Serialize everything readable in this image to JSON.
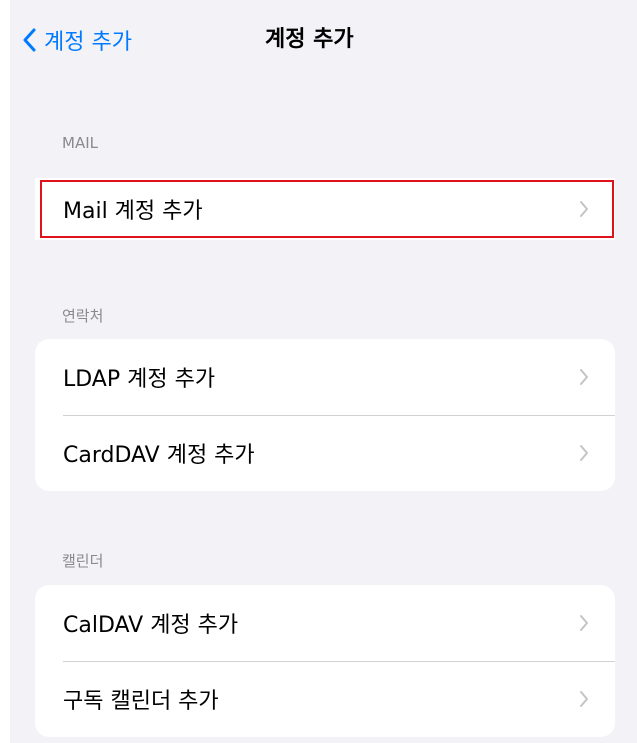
{
  "navbar": {
    "back_label": "계정 추가",
    "title": "계정 추가"
  },
  "sections": {
    "mail": {
      "header": "MAIL",
      "rows": [
        "Mail 계정 추가"
      ]
    },
    "contacts": {
      "header": "연락처",
      "rows": [
        "LDAP 계정 추가",
        "CardDAV 계정 추가"
      ]
    },
    "calendar": {
      "header": "캘린더",
      "rows": [
        "CalDAV 계정 추가",
        "구독 캘린더 추가"
      ]
    }
  },
  "colors": {
    "accent": "#007aff",
    "highlight": "#e0121c",
    "background": "#f2f2f7"
  }
}
